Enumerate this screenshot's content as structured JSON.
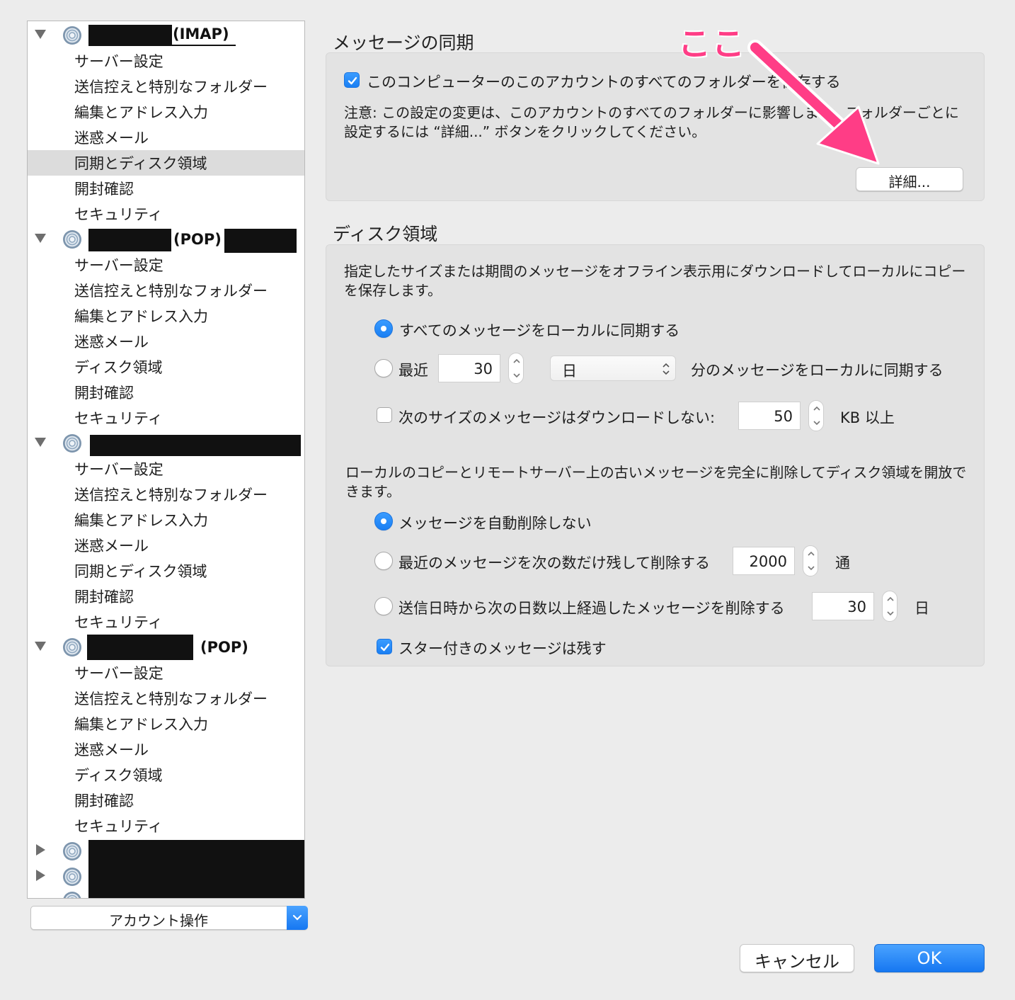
{
  "sidebar": {
    "accounts": [
      {
        "tag": "(IMAP)",
        "items": [
          "サーバー設定",
          "送信控えと特別なフォルダー",
          "編集とアドレス入力",
          "迷惑メール",
          "同期とディスク領域",
          "開封確認",
          "セキュリティ"
        ],
        "selected_index": 4
      },
      {
        "tag": "(POP)",
        "items": [
          "サーバー設定",
          "送信控えと特別なフォルダー",
          "編集とアドレス入力",
          "迷惑メール",
          "ディスク領域",
          "開封確認",
          "セキュリティ"
        ]
      },
      {
        "tag": "",
        "items": [
          "サーバー設定",
          "送信控えと特別なフォルダー",
          "編集とアドレス入力",
          "迷惑メール",
          "同期とディスク領域",
          "開封確認",
          "セキュリティ"
        ]
      },
      {
        "tag": "(POP)",
        "items": [
          "サーバー設定",
          "送信控えと特別なフォルダー",
          "編集とアドレス入力",
          "迷惑メール",
          "ディスク領域",
          "開封確認",
          "セキュリティ"
        ]
      }
    ],
    "account_ops_label": "アカウント操作"
  },
  "sync_section": {
    "title": "メッセージの同期",
    "keep_all_label": "このコンピューターのこのアカウントのすべてのフォルダーを保存する",
    "keep_all_checked": true,
    "note": "注意: この設定の変更は、このアカウントのすべてのフォルダーに影響します。フォルダーごとに設定するには “詳細...” ボタンをクリックしてください。",
    "advanced_button": "詳細..."
  },
  "disk_section": {
    "title": "ディスク領域",
    "description": "指定したサイズまたは期間のメッセージをオフライン表示用にダウンロードしてローカルにコピーを保存します。",
    "sync_all_label": "すべてのメッセージをローカルに同期する",
    "recent_label": "最近",
    "recent_value": "30",
    "recent_unit": "日",
    "recent_suffix": "分のメッセージをローカルに同期する",
    "size_limit_label": "次のサイズのメッセージはダウンロードしない:",
    "size_limit_value": "50",
    "size_limit_unit": "KB 以上",
    "cleanup_description": "ローカルのコピーとリモートサーバー上の古いメッセージを完全に削除してディスク領域を開放できます。",
    "no_delete_label": "メッセージを自動削除しない",
    "keep_count_label": "最近のメッセージを次の数だけ残して削除する",
    "keep_count_value": "2000",
    "keep_count_unit": "通",
    "delete_days_label": "送信日時から次の日数以上経過したメッセージを削除する",
    "delete_days_value": "30",
    "delete_days_unit": "日",
    "keep_starred_label": "スター付きのメッセージは残す"
  },
  "footer": {
    "cancel": "キャンセル",
    "ok": "OK"
  },
  "annotation": {
    "text": "ここ",
    "color": "#ff3d86"
  },
  "colors": {
    "accent": "#1a7ff3",
    "panel": "#e3e3e3",
    "background": "#ececec"
  }
}
